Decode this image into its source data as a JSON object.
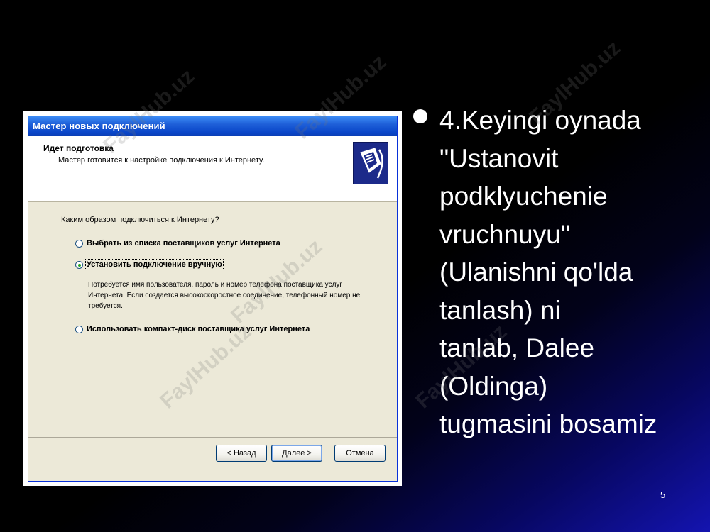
{
  "watermark": "FaylHub.uz",
  "dialog": {
    "title": "Мастер новых подключений",
    "header_title": "Идет подготовка",
    "header_subtitle": "Мастер готовится к настройке подключения к Интернету.",
    "question": "Каким образом подключиться к Интернету?",
    "options": [
      {
        "label": "Выбрать из списка поставщиков услуг Интернета",
        "checked": false
      },
      {
        "label": "Установить подключение вручную",
        "checked": true
      },
      {
        "label": "Использовать компакт-диск поставщика услуг Интернета",
        "checked": false
      }
    ],
    "option_description": "Потребуется имя пользователя, пароль и  номер телефона поставщика услуг Интернета. Если создается высокоскоростное соединение, телефонный номер не требуется.",
    "buttons": {
      "back": "< Назад",
      "next": "Далее >",
      "cancel": "Отмена"
    }
  },
  "slide": {
    "bullet_text": "4.Keyingi oynada\n\"Ustanovit\npodklyuchenie\nvruchnuyu\"\n(Ulanishni qo'lda\ntanlash) ni\ntanlab, Dalee\n(Oldinga)\ntugmasini bosamiz",
    "page_number": "5"
  },
  "colors": {
    "titlebar": "#0a46c9",
    "dialog_bg": "#ece9d8",
    "text_white": "#ffffff"
  }
}
